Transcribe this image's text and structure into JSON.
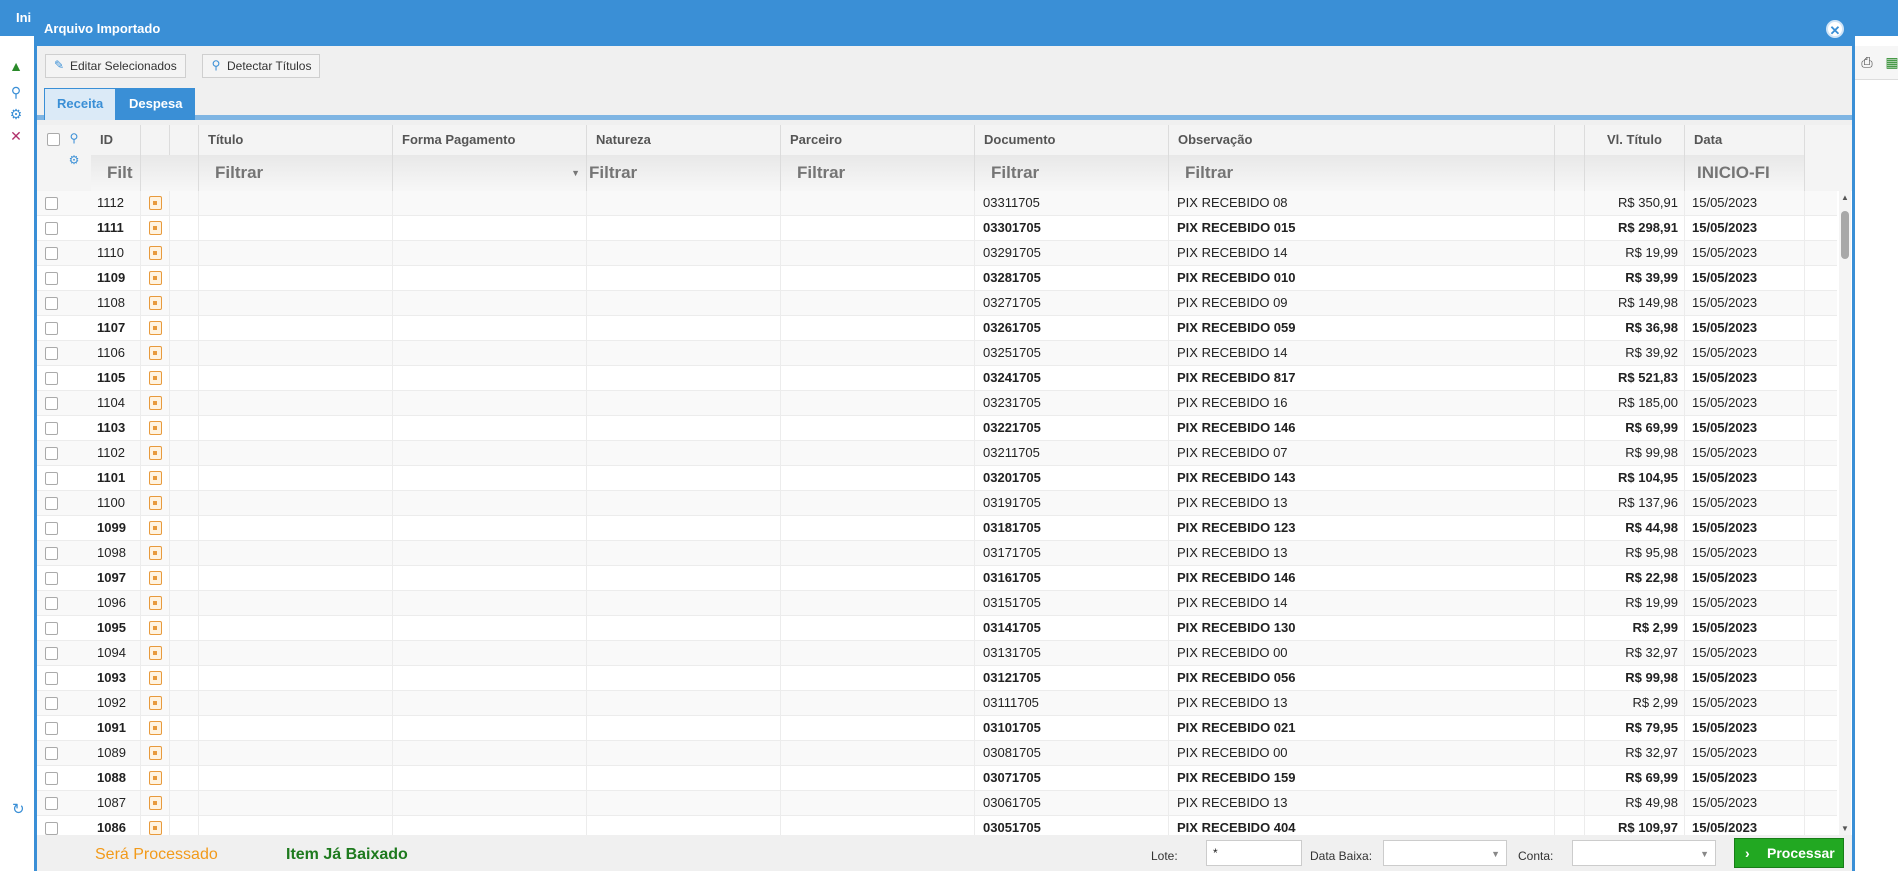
{
  "background": {
    "title_fragment": "Ini"
  },
  "modal": {
    "title": "Arquivo Importado",
    "toolbar": {
      "edit_label": "Editar Selecionados",
      "detect_label": "Detectar Títulos"
    },
    "tabs": [
      {
        "label": "Receita",
        "active": false
      },
      {
        "label": "Despesa",
        "active": true
      }
    ]
  },
  "grid": {
    "columns": {
      "id": "ID",
      "titulo": "Título",
      "forma": "Forma Pagamento",
      "natureza": "Natureza",
      "parceiro": "Parceiro",
      "documento": "Documento",
      "observacao": "Observação",
      "valor": "Vl. Título",
      "data": "Data"
    },
    "filters": {
      "id": "Filt",
      "titulo": "Filtrar",
      "natureza": "Filtrar",
      "parceiro": "Filtrar",
      "documento": "Filtrar",
      "observacao": "Filtrar",
      "data": "INICIO-FI"
    },
    "rows": [
      {
        "id": "1112",
        "doc": "03311705",
        "obs": "PIX RECEBIDO 08",
        "valor": "R$ 350,91",
        "data": "15/05/2023"
      },
      {
        "id": "1111",
        "doc": "03301705",
        "obs": "PIX RECEBIDO 015",
        "valor": "R$ 298,91",
        "data": "15/05/2023"
      },
      {
        "id": "1110",
        "doc": "03291705",
        "obs": "PIX RECEBIDO 14",
        "valor": "R$ 19,99",
        "data": "15/05/2023"
      },
      {
        "id": "1109",
        "doc": "03281705",
        "obs": "PIX RECEBIDO 010",
        "valor": "R$ 39,99",
        "data": "15/05/2023"
      },
      {
        "id": "1108",
        "doc": "03271705",
        "obs": "PIX RECEBIDO 09",
        "valor": "R$ 149,98",
        "data": "15/05/2023"
      },
      {
        "id": "1107",
        "doc": "03261705",
        "obs": "PIX RECEBIDO 059",
        "valor": "R$ 36,98",
        "data": "15/05/2023"
      },
      {
        "id": "1106",
        "doc": "03251705",
        "obs": "PIX RECEBIDO 14",
        "valor": "R$ 39,92",
        "data": "15/05/2023"
      },
      {
        "id": "1105",
        "doc": "03241705",
        "obs": "PIX RECEBIDO 817",
        "valor": "R$ 521,83",
        "data": "15/05/2023"
      },
      {
        "id": "1104",
        "doc": "03231705",
        "obs": "PIX RECEBIDO 16",
        "valor": "R$ 185,00",
        "data": "15/05/2023"
      },
      {
        "id": "1103",
        "doc": "03221705",
        "obs": "PIX RECEBIDO 146",
        "valor": "R$ 69,99",
        "data": "15/05/2023"
      },
      {
        "id": "1102",
        "doc": "03211705",
        "obs": "PIX RECEBIDO 07",
        "valor": "R$ 99,98",
        "data": "15/05/2023"
      },
      {
        "id": "1101",
        "doc": "03201705",
        "obs": "PIX RECEBIDO 143",
        "valor": "R$ 104,95",
        "data": "15/05/2023"
      },
      {
        "id": "1100",
        "doc": "03191705",
        "obs": "PIX RECEBIDO 13",
        "valor": "R$ 137,96",
        "data": "15/05/2023"
      },
      {
        "id": "1099",
        "doc": "03181705",
        "obs": "PIX RECEBIDO 123",
        "valor": "R$ 44,98",
        "data": "15/05/2023"
      },
      {
        "id": "1098",
        "doc": "03171705",
        "obs": "PIX RECEBIDO 13",
        "valor": "R$ 95,98",
        "data": "15/05/2023"
      },
      {
        "id": "1097",
        "doc": "03161705",
        "obs": "PIX RECEBIDO 146",
        "valor": "R$ 22,98",
        "data": "15/05/2023"
      },
      {
        "id": "1096",
        "doc": "03151705",
        "obs": "PIX RECEBIDO 14",
        "valor": "R$ 19,99",
        "data": "15/05/2023"
      },
      {
        "id": "1095",
        "doc": "03141705",
        "obs": "PIX RECEBIDO 130",
        "valor": "R$ 2,99",
        "data": "15/05/2023"
      },
      {
        "id": "1094",
        "doc": "03131705",
        "obs": "PIX RECEBIDO 00",
        "valor": "R$ 32,97",
        "data": "15/05/2023"
      },
      {
        "id": "1093",
        "doc": "03121705",
        "obs": "PIX RECEBIDO 056",
        "valor": "R$ 99,98",
        "data": "15/05/2023"
      },
      {
        "id": "1092",
        "doc": "03111705",
        "obs": "PIX RECEBIDO 13",
        "valor": "R$ 2,99",
        "data": "15/05/2023"
      },
      {
        "id": "1091",
        "doc": "03101705",
        "obs": "PIX RECEBIDO 021",
        "valor": "R$ 79,95",
        "data": "15/05/2023"
      },
      {
        "id": "1089",
        "doc": "03081705",
        "obs": "PIX RECEBIDO 00",
        "valor": "R$ 32,97",
        "data": "15/05/2023"
      },
      {
        "id": "1088",
        "doc": "03071705",
        "obs": "PIX RECEBIDO 159",
        "valor": "R$ 69,99",
        "data": "15/05/2023"
      },
      {
        "id": "1087",
        "doc": "03061705",
        "obs": "PIX RECEBIDO 13",
        "valor": "R$ 49,98",
        "data": "15/05/2023"
      },
      {
        "id": "1086",
        "doc": "03051705",
        "obs": "PIX RECEBIDO 404",
        "valor": "R$ 109,97",
        "data": "15/05/2023"
      }
    ]
  },
  "footer": {
    "legend_process": "Será Processado",
    "legend_done": "Item Já Baixado",
    "lote_label": "Lote:",
    "lote_value": "*",
    "data_baixa_label": "Data Baixa:",
    "conta_label": "Conta:",
    "process_button": "Processar"
  },
  "colors": {
    "accent": "#3a8fd6",
    "legend_process": "#f29a1a",
    "legend_done": "#1e7a1e",
    "process_button": "#22a822"
  }
}
